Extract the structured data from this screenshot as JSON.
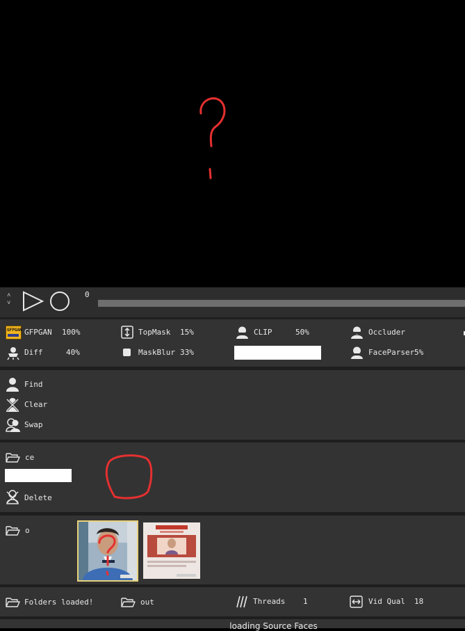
{
  "transport": {
    "frame_number": "0",
    "progress": 0.0,
    "up_arrow": "˄",
    "down_arrow": "˅"
  },
  "params": {
    "gfpgan_label": "GFPGAN",
    "gfpgan_value": "100%",
    "topmask_label": "TopMask",
    "topmask_value": "15%",
    "clip_label": "CLIP",
    "clip_value": "50%",
    "occluder_label": "Occluder",
    "diff_label": "Diff",
    "diff_value": "40%",
    "maskblur_label": "MaskBlur",
    "maskblur_value": "33%",
    "clip_text_value": "",
    "faceparser_label": "FaceParser",
    "faceparser_value": "5%",
    "gfpgan_icon_text": "GFPGAN"
  },
  "actions": {
    "find_label": "Find",
    "clear_label": "Clear",
    "swap_label": "Swap"
  },
  "source": {
    "folder_label": "ce",
    "input_value": "",
    "delete_label": "Delete"
  },
  "target": {
    "folder_label": "o"
  },
  "bottom": {
    "folders_loaded_label": "Folders loaded!",
    "out_label": "out",
    "threads_label": "Threads",
    "threads_value": "1",
    "vidqual_label": "Vid Qual",
    "vidqual_value": "18"
  },
  "status": {
    "text": "loading Source Faces"
  },
  "colors": {
    "panel": "#333333",
    "separator": "#1e1e1e",
    "annotation_red": "#e53030",
    "selected_border": "#e8d27a",
    "accent_yellow": "#f0b41e"
  },
  "annotations": {
    "preview_scribble": "question-mark",
    "source_scribble": "circle",
    "thumbnail_scribble": "question-mark"
  }
}
